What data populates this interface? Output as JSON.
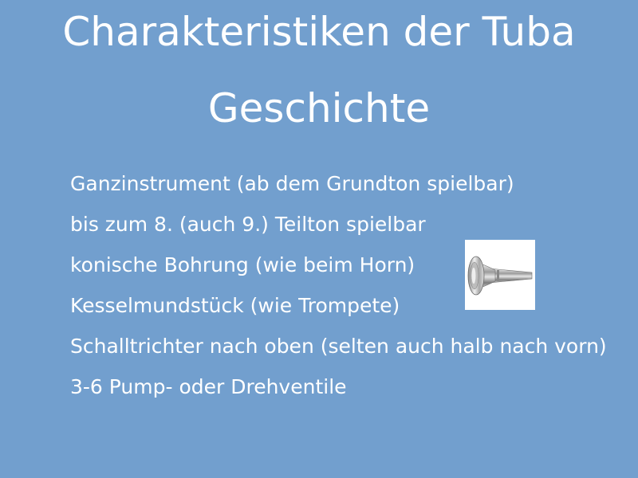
{
  "slide": {
    "title_line1": "Charakteristiken der Tuba",
    "title_line2": "Geschichte",
    "bullets": [
      "Ganzinstrument (ab dem Grundton spielbar)",
      "bis zum 8. (auch 9.) Teilton spielbar",
      "konische Bohrung (wie beim Horn)",
      "Kesselmundstück (wie Trompete)",
      "Schalltrichter nach oben (selten auch halb nach vorn)",
      "3-6 Pump- oder Drehventile"
    ],
    "image_icon": "mouthpiece-icon"
  },
  "colors": {
    "background": "#729fce",
    "text": "#ffffff"
  }
}
